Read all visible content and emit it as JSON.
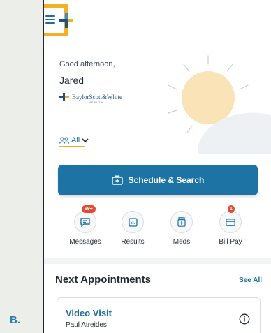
{
  "panel_label": "B.",
  "greeting": {
    "salutation": "Good afternoon,",
    "name": "Jared",
    "brand_name": "BaylorScott&White",
    "brand_sub": "HEALTH"
  },
  "filter": {
    "label": "All"
  },
  "schedule_button": {
    "label": "Schedule & Search"
  },
  "quick_actions": [
    {
      "label": "Messages",
      "icon": "message-icon",
      "badge": "99+"
    },
    {
      "label": "Results",
      "icon": "chart-icon",
      "badge": ""
    },
    {
      "label": "Meds",
      "icon": "pill-bottle-icon",
      "badge": ""
    },
    {
      "label": "Bill Pay",
      "icon": "credit-card-icon",
      "badge": "1"
    }
  ],
  "appointments": {
    "title": "Next Appointments",
    "see_all": "See All",
    "items": [
      {
        "title": "Video Visit",
        "provider": "Paul Atreides"
      }
    ]
  },
  "colors": {
    "primary": "#1d74a4",
    "highlight": "#f4b024",
    "badge": "#e24b2f",
    "sun": "#fbe3b8"
  }
}
